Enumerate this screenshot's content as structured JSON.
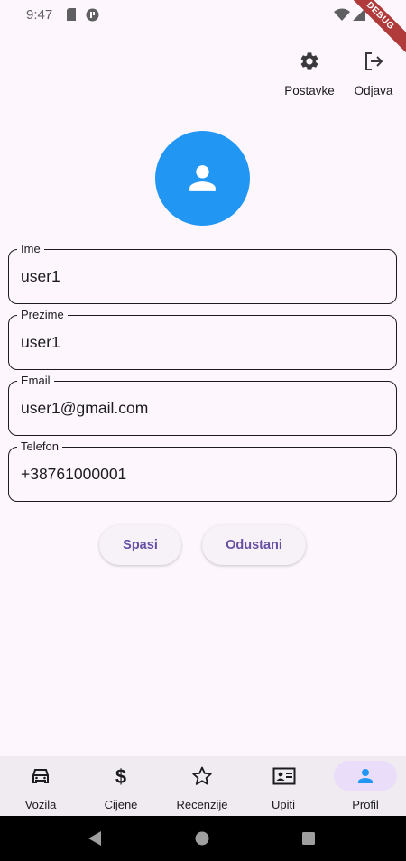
{
  "status_bar": {
    "time": "9:47",
    "debug_label": "DEBUG"
  },
  "top_actions": {
    "settings_label": "Postavke",
    "logout_label": "Odjava"
  },
  "avatar": {
    "icon": "person-icon",
    "color": "#2196f3"
  },
  "form": {
    "fields": [
      {
        "label": "Ime",
        "value": "user1"
      },
      {
        "label": "Prezime",
        "value": "user1"
      },
      {
        "label": "Email",
        "value": "user1@gmail.com"
      },
      {
        "label": "Telefon",
        "value": "+38761000001"
      }
    ],
    "save_label": "Spasi",
    "cancel_label": "Odustani"
  },
  "bottom_nav": {
    "items": [
      {
        "label": "Vozila",
        "icon": "car-icon"
      },
      {
        "label": "Cijene",
        "icon": "dollar-icon"
      },
      {
        "label": "Recenzije",
        "icon": "star-icon"
      },
      {
        "label": "Upiti",
        "icon": "contact-card-icon"
      },
      {
        "label": "Profil",
        "icon": "person-icon",
        "active": true
      }
    ]
  },
  "colors": {
    "accent": "#6750a4",
    "background": "#fdf7fd",
    "active_indicator": "#e9ddfa"
  }
}
